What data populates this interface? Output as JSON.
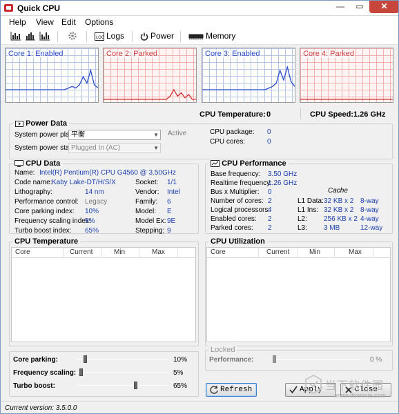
{
  "window": {
    "title": "Quick CPU",
    "minimize": "—",
    "maximize": "▭",
    "close": "✕"
  },
  "menu": [
    "Help",
    "View",
    "Edit",
    "Options"
  ],
  "toolbar": {
    "logs": "Logs",
    "power": "Power",
    "memory": "Memory"
  },
  "cores": [
    {
      "label": "Core 1: Enabled",
      "state": "enabled",
      "history": [
        6,
        6,
        6,
        6,
        6,
        6,
        6,
        6,
        6,
        6,
        6,
        6,
        6,
        6,
        6,
        6,
        6,
        7,
        8,
        7,
        9,
        14,
        10,
        18,
        9,
        7
      ]
    },
    {
      "label": "Core 2: Parked",
      "state": "parked",
      "history": [
        0,
        0,
        0,
        0,
        0,
        0,
        0,
        0,
        0,
        0,
        0,
        0,
        0,
        0,
        0,
        0,
        0,
        0,
        2,
        6,
        2,
        4,
        1,
        3,
        0,
        0
      ]
    },
    {
      "label": "Core 3: Enabled",
      "state": "enabled",
      "history": [
        6,
        6,
        6,
        6,
        6,
        6,
        6,
        6,
        6,
        6,
        6,
        6,
        6,
        6,
        6,
        6,
        6,
        6,
        7,
        8,
        10,
        18,
        12,
        20,
        11,
        8
      ]
    },
    {
      "label": "Core 4: Parked",
      "state": "parked",
      "history": [
        0,
        0,
        0,
        0,
        0,
        0,
        0,
        0,
        0,
        0,
        0,
        0,
        0,
        0,
        0,
        0,
        0,
        0,
        0,
        0,
        0,
        0,
        0,
        0,
        0,
        0
      ]
    }
  ],
  "stats": {
    "temperature_label": "CPU Temperature:",
    "temperature_value": "0",
    "speed_label": "CPU Speed:",
    "speed_value": "1.26 GHz"
  },
  "power_data": {
    "title": "Power Data",
    "plan_label": "System power plan:",
    "plan_value": "平衡",
    "plan_status": "Active",
    "state_label": "System power state:",
    "state_value": "Plugged In (AC)",
    "package_label": "CPU package:",
    "package_value": "0",
    "cores_label": "CPU cores:",
    "cores_value": "0"
  },
  "cpu_data": {
    "title": "CPU Data",
    "name_label": "Name:",
    "name_value": "Intel(R) Pentium(R) CPU G4560 @ 3.50GHz",
    "rows": [
      {
        "label": "Code name:",
        "value": "Kaby Lake-DT/H/S/X",
        "label2": "Socket:",
        "value2": "1/1"
      },
      {
        "label": "Lithography:",
        "value": "14 nm",
        "label2": "Vendor:",
        "value2": "Intel"
      },
      {
        "label": "Performance control:",
        "value": "Legacy",
        "label2": "Family:",
        "value2": "6"
      },
      {
        "label": "Core parking index:",
        "value": "10%",
        "label2": "Model:",
        "value2": "E"
      },
      {
        "label": "Frequency scaling index:",
        "value": "5%",
        "label2": "Model Ex:",
        "value2": "9E"
      },
      {
        "label": "Turbo boost index:",
        "value": "65%",
        "label2": "Stepping:",
        "value2": "9"
      }
    ]
  },
  "cpu_performance": {
    "title": "CPU Performance",
    "rows": [
      {
        "label": "Base frequency:",
        "value": "3.50 GHz"
      },
      {
        "label": "Realtime frequency:",
        "value": "1.26 GHz"
      },
      {
        "label": "Bus x Multiplier:",
        "value": "0"
      },
      {
        "label": "Number of cores:",
        "value": "2"
      },
      {
        "label": "Logical processors:",
        "value": "4"
      },
      {
        "label": "Enabled cores:",
        "value": "2"
      },
      {
        "label": "Parked cores:",
        "value": "2"
      }
    ],
    "cache_title": "Cache",
    "cache": [
      {
        "label": "L1 Data:",
        "size": "32 KB x 2",
        "ways": "8-way"
      },
      {
        "label": "L1 Ins:",
        "size": "32 KB x 2",
        "ways": "8-way"
      },
      {
        "label": "L2:",
        "size": "256 KB x 2",
        "ways": "4-way"
      },
      {
        "label": "L3:",
        "size": "3 MB",
        "ways": "12-way"
      }
    ]
  },
  "cpu_temperature": {
    "title": "CPU Temperature",
    "columns": [
      "Core",
      "Current",
      "Min",
      "Max"
    ]
  },
  "cpu_utilization": {
    "title": "CPU Utilization",
    "columns": [
      "Core",
      "Current",
      "Min",
      "Max"
    ]
  },
  "sliders": [
    {
      "label": "Core parking:",
      "value": "10%",
      "fraction": 0.1
    },
    {
      "label": "Frequency scaling:",
      "value": "5%",
      "fraction": 0.05
    },
    {
      "label": "Turbo boost:",
      "value": "65%",
      "fraction": 0.65
    }
  ],
  "locked": {
    "title": "Locked",
    "performance_label": "Performance:",
    "performance_value": "0 %",
    "fraction": 0.0
  },
  "buttons": {
    "refresh": "Refresh",
    "apply": "Apply",
    "close": "Close"
  },
  "status": {
    "version": "Current version:  3.5.0.0"
  },
  "watermark": {
    "text1": "当下软件园",
    "text2": "www.downxia.com"
  },
  "colors": {
    "enabled_line": "#2a4ccc",
    "parked_line": "#d42a2a"
  }
}
